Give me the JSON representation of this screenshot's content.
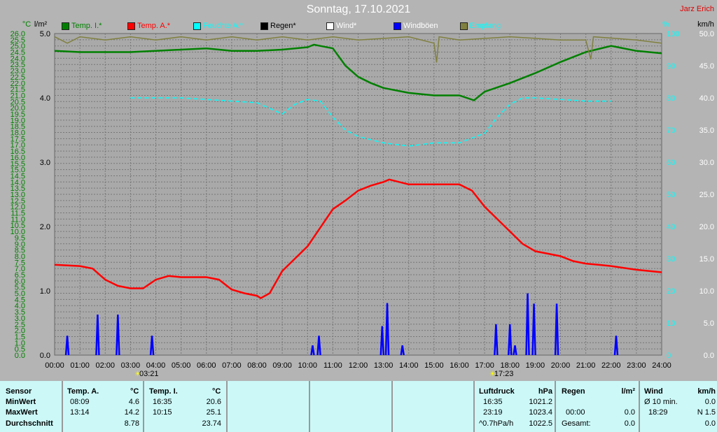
{
  "title": "Sonntag, 17.10.2021",
  "author": "Jarz Erich",
  "axes": {
    "left1_unit": "°C",
    "left2_unit": "l/m²",
    "right1_unit": "%",
    "right2_unit": "km/h"
  },
  "legend": [
    {
      "label": "Temp. I.*",
      "color": "#008000",
      "text": "#008000"
    },
    {
      "label": "Temp. A.*",
      "color": "#ff0000",
      "text": "#ff0000"
    },
    {
      "label": "Feuchte A.*",
      "color": "#00ffff",
      "text": "#00ffff"
    },
    {
      "label": "Regen*",
      "color": "#000000",
      "text": "#000000"
    },
    {
      "label": "Wind*",
      "color": "#ffffff",
      "text": "#ffffff"
    },
    {
      "label": "Windböen",
      "color": "#0000ff",
      "text": "#ffffff"
    },
    {
      "label": "Empfang",
      "color": "#808040",
      "text": "#00ffff"
    }
  ],
  "markers": [
    {
      "label": "03:21",
      "hour": 3.35
    },
    {
      "label": "17:23",
      "hour": 17.38
    }
  ],
  "chart_data": {
    "type": "line",
    "title": "Sonntag, 17.10.2021",
    "xlabel": "",
    "xlim": [
      0,
      24
    ],
    "x_ticks": [
      "00:00",
      "01:00",
      "02:00",
      "03:00",
      "04:00",
      "05:00",
      "06:00",
      "07:00",
      "08:00",
      "09:00",
      "10:00",
      "11:00",
      "12:00",
      "13:00",
      "14:00",
      "15:00",
      "16:00",
      "17:00",
      "18:00",
      "19:00",
      "20:00",
      "21:00",
      "22:00",
      "23:00",
      "24:00"
    ],
    "ylim_temp": [
      0,
      26
    ],
    "ylim_rain": [
      0,
      5
    ],
    "ylim_pct": [
      0,
      100
    ],
    "ylim_kmh": [
      0,
      50
    ],
    "series": [
      {
        "name": "Temp. A.",
        "axis": "temp",
        "color": "#ff0000",
        "points": [
          [
            0,
            7.3
          ],
          [
            1,
            7.2
          ],
          [
            1.5,
            7.0
          ],
          [
            2,
            6.1
          ],
          [
            2.5,
            5.6
          ],
          [
            3,
            5.4
          ],
          [
            3.5,
            5.4
          ],
          [
            4,
            6.1
          ],
          [
            4.5,
            6.4
          ],
          [
            5,
            6.3
          ],
          [
            6,
            6.3
          ],
          [
            6.5,
            6.1
          ],
          [
            7,
            5.3
          ],
          [
            7.5,
            5.0
          ],
          [
            8,
            4.8
          ],
          [
            8.15,
            4.6
          ],
          [
            8.5,
            5.0
          ],
          [
            9,
            6.8
          ],
          [
            9.5,
            7.8
          ],
          [
            10,
            8.8
          ],
          [
            10.5,
            10.3
          ],
          [
            11,
            11.8
          ],
          [
            11.5,
            12.5
          ],
          [
            12,
            13.3
          ],
          [
            12.5,
            13.7
          ],
          [
            13,
            14.0
          ],
          [
            13.23,
            14.2
          ],
          [
            14,
            13.8
          ],
          [
            15,
            13.8
          ],
          [
            16,
            13.8
          ],
          [
            16.5,
            13.3
          ],
          [
            17,
            12.0
          ],
          [
            17.5,
            11.0
          ],
          [
            18,
            10.0
          ],
          [
            18.5,
            9.0
          ],
          [
            19,
            8.4
          ],
          [
            19.5,
            8.2
          ],
          [
            20,
            8.0
          ],
          [
            20.5,
            7.6
          ],
          [
            21,
            7.4
          ],
          [
            21.5,
            7.3
          ],
          [
            22,
            7.2
          ],
          [
            23,
            6.9
          ],
          [
            24,
            6.7
          ]
        ]
      },
      {
        "name": "Temp. I.",
        "axis": "temp",
        "color": "#008000",
        "points": [
          [
            0,
            24.6
          ],
          [
            1,
            24.5
          ],
          [
            2,
            24.5
          ],
          [
            3,
            24.5
          ],
          [
            4,
            24.6
          ],
          [
            5,
            24.7
          ],
          [
            6,
            24.8
          ],
          [
            7,
            24.6
          ],
          [
            8,
            24.6
          ],
          [
            9,
            24.7
          ],
          [
            10,
            24.9
          ],
          [
            10.25,
            25.1
          ],
          [
            11,
            24.8
          ],
          [
            11.5,
            23.4
          ],
          [
            12,
            22.5
          ],
          [
            12.5,
            22.0
          ],
          [
            13,
            21.6
          ],
          [
            14,
            21.2
          ],
          [
            15,
            21.0
          ],
          [
            16,
            21.0
          ],
          [
            16.58,
            20.6
          ],
          [
            17,
            21.3
          ],
          [
            18,
            22.0
          ],
          [
            19,
            22.8
          ],
          [
            20,
            23.7
          ],
          [
            21,
            24.5
          ],
          [
            22,
            25.0
          ],
          [
            23,
            24.6
          ],
          [
            24,
            24.4
          ]
        ]
      },
      {
        "name": "Feuchte A.",
        "axis": "pct",
        "color": "#00ffff",
        "points": [
          [
            3,
            80
          ],
          [
            5,
            80
          ],
          [
            7,
            79
          ],
          [
            8,
            78.5
          ],
          [
            9,
            75
          ],
          [
            9.5,
            78
          ],
          [
            10,
            79.5
          ],
          [
            10.5,
            79
          ],
          [
            11,
            74
          ],
          [
            11.5,
            70
          ],
          [
            12,
            68
          ],
          [
            13,
            66
          ],
          [
            14,
            65
          ],
          [
            15,
            66
          ],
          [
            16,
            66
          ],
          [
            17,
            69
          ],
          [
            17.5,
            74
          ],
          [
            18,
            78
          ],
          [
            18.5,
            80
          ],
          [
            19,
            80
          ],
          [
            20,
            79.5
          ],
          [
            21,
            79
          ],
          [
            22,
            79
          ]
        ]
      },
      {
        "name": "Empfang",
        "axis": "pct",
        "color": "#808040",
        "points": [
          [
            0,
            99
          ],
          [
            0.5,
            97
          ],
          [
            1,
            99
          ],
          [
            2,
            98
          ],
          [
            3,
            99
          ],
          [
            4,
            98
          ],
          [
            5,
            99
          ],
          [
            6,
            98
          ],
          [
            7,
            99
          ],
          [
            8,
            98
          ],
          [
            9,
            99
          ],
          [
            10,
            98
          ],
          [
            11,
            99
          ],
          [
            12,
            98
          ],
          [
            14,
            99
          ],
          [
            15,
            97
          ],
          [
            15.1,
            91
          ],
          [
            15.2,
            99
          ],
          [
            16,
            98
          ],
          [
            18,
            99
          ],
          [
            20,
            98
          ],
          [
            21,
            98
          ],
          [
            21.2,
            92
          ],
          [
            21.3,
            99
          ],
          [
            23,
            98
          ],
          [
            24,
            97
          ]
        ]
      },
      {
        "name": "Windböen",
        "axis": "kmh",
        "color": "#0000ff",
        "points": [
          [
            0.5,
            3
          ],
          [
            1.7,
            6.3
          ],
          [
            2.5,
            6.3
          ],
          [
            3.85,
            3
          ],
          [
            10.2,
            1.5
          ],
          [
            10.45,
            3
          ],
          [
            12.95,
            4.5
          ],
          [
            13.15,
            8.1
          ],
          [
            13.75,
            1.5
          ],
          [
            17.45,
            4.8
          ],
          [
            18,
            4.8
          ],
          [
            18.2,
            1.5
          ],
          [
            18.7,
            9.6
          ],
          [
            18.95,
            8
          ],
          [
            19.85,
            8
          ],
          [
            22.2,
            3
          ]
        ]
      }
    ]
  },
  "table": {
    "sensor": {
      "h": "Sensor",
      "min": "MinWert",
      "max": "MaxWert",
      "avg": "Durchschnitt"
    },
    "tempA": {
      "h": "Temp. A.",
      "u": "°C",
      "min_t": "08:09",
      "min": "4.6",
      "max_t": "13:14",
      "max": "14.2",
      "avg": "8.78"
    },
    "tempI": {
      "h": "Temp. I.",
      "u": "°C",
      "min_t": "16:35",
      "min": "20.6",
      "max_t": "10:15",
      "max": "25.1",
      "avg": "23.74"
    },
    "press": {
      "h": "Luftdruck",
      "u": "hPa",
      "min_t": "16:35",
      "min": "1021.2",
      "max_t": "23:19",
      "max": "1023.4",
      "trend": "^0.7hPa/h",
      "avg": "1022.5"
    },
    "rain": {
      "h": "Regen",
      "u": "l/m²",
      "t": "00:00",
      "v": "0.0",
      "tot_l": "Gesamt:",
      "tot": "0.0"
    },
    "wind": {
      "h": "Wind",
      "u": "km/h",
      "avg_l": "Ø 10 min.",
      "avg": "0.0",
      "max_t": "18:29",
      "max": "N 1.5",
      "last": "0.0"
    }
  }
}
